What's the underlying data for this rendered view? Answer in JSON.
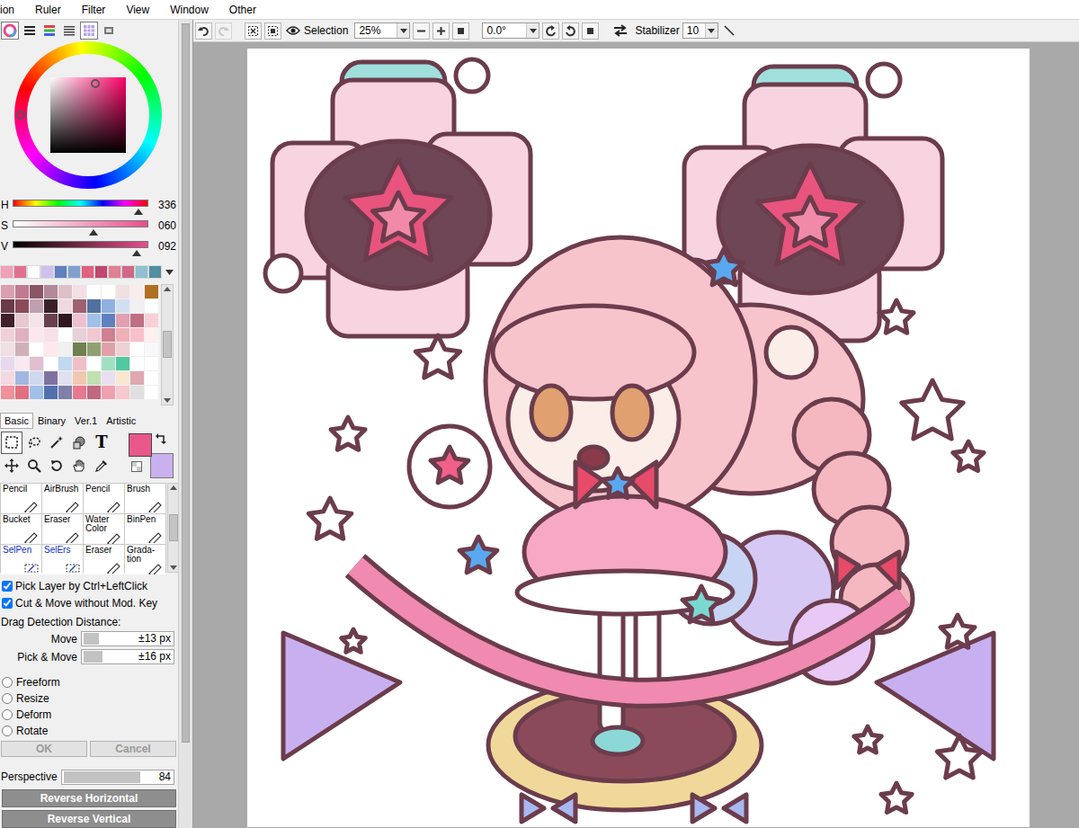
{
  "menu": [
    "ion",
    "Ruler",
    "Filter",
    "View",
    "Window",
    "Other"
  ],
  "toolbar": {
    "view_label": "Selection",
    "zoom": "25%",
    "angle": "0.0°",
    "stabilizer_label": "Stabilizer",
    "stabilizer": "10"
  },
  "color_modes": [
    {
      "selected": true
    },
    {
      "selected": false
    },
    {
      "selected": false
    },
    {
      "selected": false
    },
    {
      "selected": true
    },
    {
      "selected": false
    }
  ],
  "color": {
    "sliders": [
      {
        "label": "H",
        "value": "336",
        "level": 0.933
      },
      {
        "label": "S",
        "value": "060",
        "level": 0.6
      },
      {
        "label": "V",
        "value": "092",
        "level": 0.92
      }
    ],
    "primary": "#e8588a",
    "secondary": "#c9b0ee"
  },
  "palette_strip": [
    "#f0a0b8",
    "#e07090",
    "#ffffff",
    "#d0c0f0",
    "#6080c0",
    "#80a0d0",
    "#e06080",
    "#c04870",
    "#e08090",
    "#d06888",
    "#90c0d0",
    "#5090a0"
  ],
  "swatches": [
    "#d9a0b0",
    "#c07a90",
    "#8a5566",
    "#b08a98",
    "#e0c0c8",
    "#f2e0e4",
    "#ffffff",
    "#ffffff",
    "#f0e0e0",
    "#f8ecec",
    "#b07020",
    "#6a3a48",
    "#8a4a5a",
    "#c0a0b0",
    "#3a2028",
    "#f0d8e0",
    "#a06070",
    "#5070a0",
    "#90b0e0",
    "#d0e0f0",
    "#f0f0f0",
    "#ffffff",
    "#40202a",
    "#e8c8d0",
    "#f4e4e8",
    "#6a4050",
    "#301820",
    "#f0c0d0",
    "#a0c0e8",
    "#6080c0",
    "#e0a0b0",
    "#c07080",
    "#f8d0d8",
    "#f0d0d8",
    "#e0b0c0",
    "#fce8ec",
    "#f8e0e8",
    "#ffffff",
    "#e8d0d8",
    "#f0c8d0",
    "#d08090",
    "#f0b0b8",
    "#f8c0c8",
    "#fff0f0",
    "#f0e0e4",
    "#d0b0b8",
    "#ffffff",
    "#ffe8ec",
    "#f0f0f0",
    "#708050",
    "#90a070",
    "#e0a0a8",
    "#f0d0d0",
    "#ffffff",
    "#f8f8f8",
    "#e8d8f0",
    "#f8e8f0",
    "#e0c0d0",
    "#ffffff",
    "#c0d8f0",
    "#f0c0c8",
    "#ffffff",
    "#a0e0c0",
    "#50c8a0",
    "#ffffff",
    "#ffffff",
    "#f4d8e0",
    "#a0b8e0",
    "#d0d8f0",
    "#8070a0",
    "#e0e0f0",
    "#f0c8b0",
    "#c0e0b0",
    "#e8e0f0",
    "#f8e8d0",
    "#e0a8b0",
    "#ffffff",
    "#f09098",
    "#e07080",
    "#a0c0e8",
    "#5070b0",
    "#8080a8",
    "#e87890",
    "#c06880",
    "#f0a0b0",
    "#f8c8d0",
    "#e0e0e0",
    "#ffffff"
  ],
  "tool_tabs": [
    {
      "label": "Basic",
      "selected": true
    },
    {
      "label": "Binary",
      "selected": false
    },
    {
      "label": "Ver.1",
      "selected": false
    },
    {
      "label": "Artistic",
      "selected": false
    }
  ],
  "tools": [
    {
      "selected": true
    },
    {
      "selected": false
    },
    {
      "selected": false
    },
    {
      "selected": false
    },
    {
      "selected": false,
      "glyph": "T"
    },
    {
      "selected": false
    },
    {
      "selected": false
    },
    {
      "selected": false
    },
    {
      "selected": false
    },
    {
      "selected": false
    }
  ],
  "brushes": [
    {
      "label": "Pencil",
      "kind": "paint"
    },
    {
      "label": "AirBrush",
      "kind": "paint"
    },
    {
      "label": "Pencil",
      "kind": "paint"
    },
    {
      "label": "Brush",
      "kind": "paint"
    },
    {
      "label": "Bucket",
      "kind": "paint"
    },
    {
      "label": "Eraser",
      "kind": "paint"
    },
    {
      "label": "Water Color",
      "kind": "paint"
    },
    {
      "label": "BinPen",
      "kind": "paint"
    },
    {
      "label": "SelPen",
      "kind": "selection"
    },
    {
      "label": "SelErs",
      "kind": "selection"
    },
    {
      "label": "Eraser",
      "kind": "paint"
    },
    {
      "label": "Grada-tion",
      "kind": "paint"
    }
  ],
  "options": [
    {
      "label": "Pick Layer by Ctrl+LeftClick",
      "checked": true
    },
    {
      "label": "Cut & Move without Mod. Key",
      "checked": true
    }
  ],
  "drag": {
    "title": "Drag Detection Distance:",
    "rows": [
      {
        "label": "Move",
        "value": "±13 px",
        "level": 0.3
      },
      {
        "label": "Pick & Move",
        "value": "±16 px",
        "level": 0.37
      }
    ]
  },
  "transforms": [
    {
      "label": "Freeform",
      "selected": false
    },
    {
      "label": "Resize",
      "selected": false
    },
    {
      "label": "Deform",
      "selected": false
    },
    {
      "label": "Rotate",
      "selected": false
    }
  ],
  "buttons": [
    {
      "label": "OK",
      "disabled": true
    },
    {
      "label": "Cancel",
      "disabled": true
    }
  ],
  "perspective": {
    "label": "Perspective",
    "value": "84",
    "level": 0.84
  },
  "reverse": [
    "Reverse Horizontal",
    "Reverse Vertical"
  ]
}
